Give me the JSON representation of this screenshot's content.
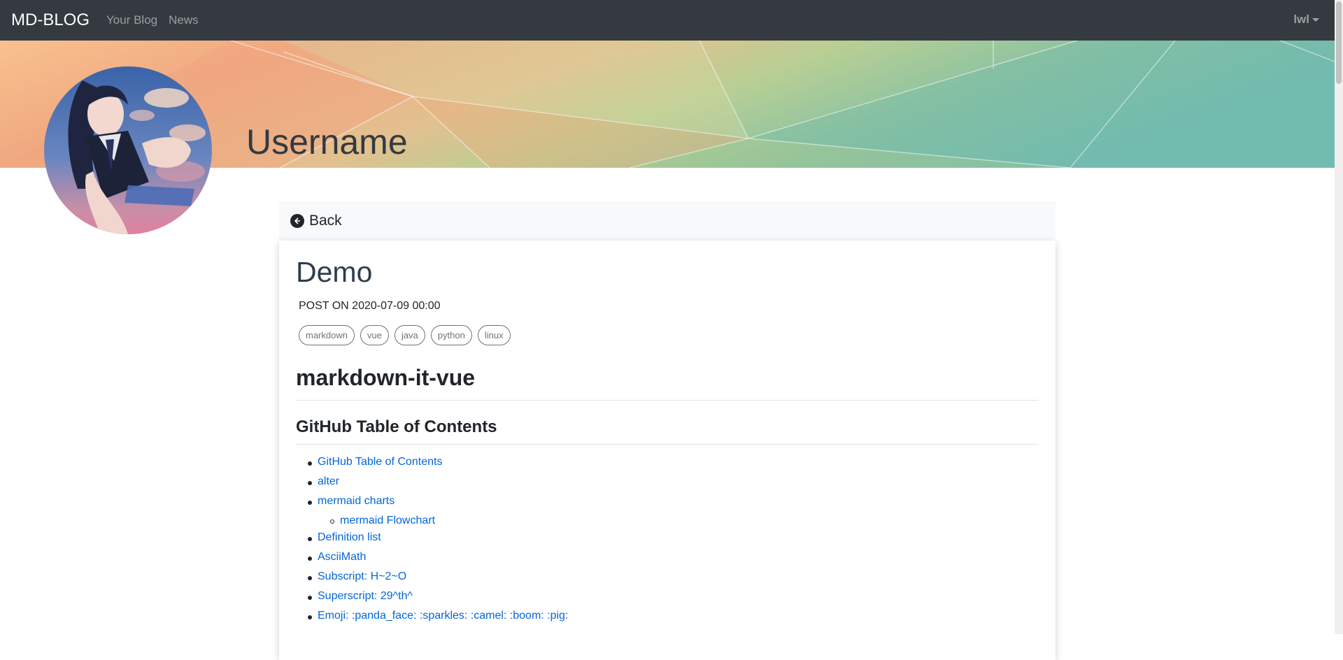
{
  "nav": {
    "brand": "MD-BLOG",
    "links": [
      "Your Blog",
      "News"
    ],
    "user": "lwl"
  },
  "profile": {
    "username": "Username"
  },
  "post": {
    "back_label": "Back",
    "title": "Demo",
    "date": "POST ON 2020-07-09 00:00",
    "tags": [
      "markdown",
      "vue",
      "java",
      "python",
      "linux"
    ],
    "h1": "markdown-it-vue",
    "h2": "GitHub Table of Contents",
    "toc": [
      {
        "label": "GitHub Table of Contents",
        "level": 1
      },
      {
        "label": "alter",
        "level": 1
      },
      {
        "label": "mermaid charts",
        "level": 1
      },
      {
        "label": "mermaid Flowchart",
        "level": 2
      },
      {
        "label": "Definition list",
        "level": 1
      },
      {
        "label": "AsciiMath",
        "level": 1
      },
      {
        "label": "Subscript: H~2~O",
        "level": 1
      },
      {
        "label": "Superscript: 29^th^",
        "level": 1
      },
      {
        "label": "Emoji: :panda_face: :sparkles: :camel: :boom: :pig:",
        "level": 1
      }
    ]
  },
  "colors": {
    "navbar": "#343a40",
    "link": "#0366d6",
    "card_header": "#f8f9fa",
    "tag_border": "#6c757d"
  },
  "icons": [
    "back-arrow-icon",
    "chevron-down-icon"
  ]
}
